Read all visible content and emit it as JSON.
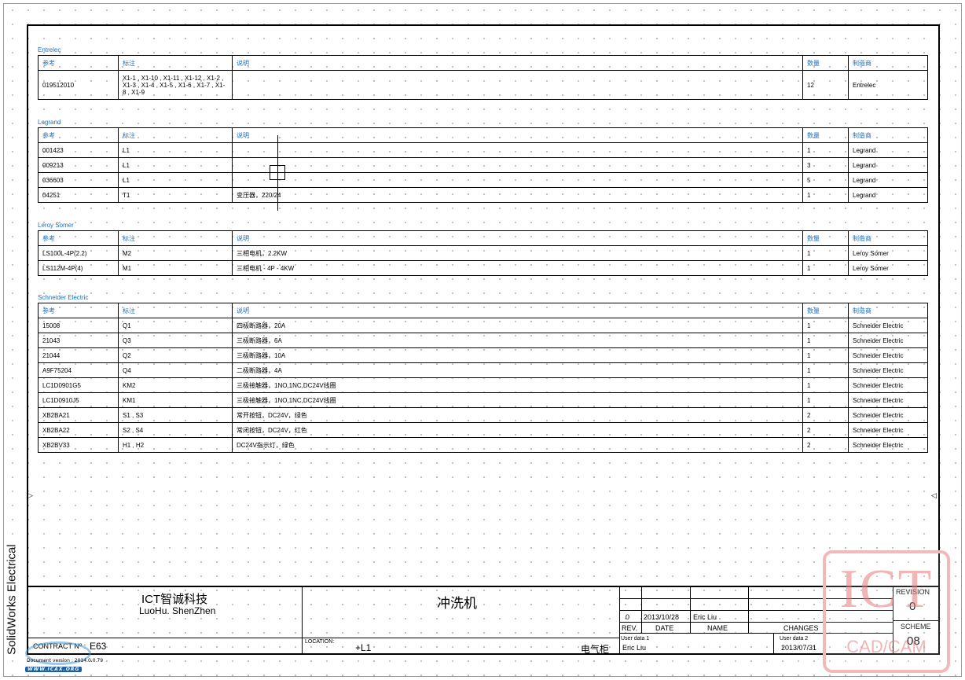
{
  "side_label": "SolidWorks Electrical",
  "headers": {
    "ref": "参考",
    "mark": "标注",
    "desc": "说明",
    "qty": "数量",
    "mfr": "制造商"
  },
  "groups": [
    {
      "title": "Entrelec",
      "rows": [
        {
          "ref": "019512010",
          "mark": "X1-1 , X1-10 , X1-11 , X1-12 , X1-2 , X1-3 , X1-4 , X1-5 , X1-6 , X1-7 , X1-8 , X1-9",
          "desc": "",
          "qty": "12",
          "mfr": "Entrelec"
        }
      ]
    },
    {
      "title": "Legrand",
      "rows": [
        {
          "ref": "001423",
          "mark": "L1",
          "desc": "",
          "qty": "1",
          "mfr": "Legrand"
        },
        {
          "ref": "009213",
          "mark": "L1",
          "desc": "",
          "qty": "3",
          "mfr": "Legrand"
        },
        {
          "ref": "036603",
          "mark": "L1",
          "desc": "",
          "qty": "5",
          "mfr": "Legrand"
        },
        {
          "ref": "04251",
          "mark": "T1",
          "desc": "变压器，220/24",
          "qty": "1",
          "mfr": "Legrand"
        }
      ]
    },
    {
      "title": "Leroy Somer",
      "rows": [
        {
          "ref": "LS100L-4P(2.2)",
          "mark": "M2",
          "desc": "三相电机，2.2KW",
          "qty": "1",
          "mfr": "Leroy Somer"
        },
        {
          "ref": "LS112M-4P(4)",
          "mark": "M1",
          "desc": "三相电机 - 4P - 4KW",
          "qty": "1",
          "mfr": "Leroy Somer"
        }
      ]
    },
    {
      "title": "Schneider Electric",
      "rows": [
        {
          "ref": "15008",
          "mark": "Q1",
          "desc": "四极断路器，20A",
          "qty": "1",
          "mfr": "Schneider Electric"
        },
        {
          "ref": "21043",
          "mark": "Q3",
          "desc": "三极断路器，6A",
          "qty": "1",
          "mfr": "Schneider Electric"
        },
        {
          "ref": "21044",
          "mark": "Q2",
          "desc": "三极断路器，10A",
          "qty": "1",
          "mfr": "Schneider Electric"
        },
        {
          "ref": "A9F75204",
          "mark": "Q4",
          "desc": "二极断路器，4A",
          "qty": "1",
          "mfr": "Schneider Electric"
        },
        {
          "ref": "LC1D0901G5",
          "mark": "KM2",
          "desc": "三极接触器，1NO,1NC,DC24V线圈",
          "qty": "1",
          "mfr": "Schneider Electric"
        },
        {
          "ref": "LC1D0910J5",
          "mark": "KM1",
          "desc": "三极接触器，1NO,1NC,DC24V线圈",
          "qty": "1",
          "mfr": "Schneider Electric"
        },
        {
          "ref": "XB2BA21",
          "mark": "S1 , S3",
          "desc": "常开按钮，DC24V，绿色",
          "qty": "2",
          "mfr": "Schneider Electric"
        },
        {
          "ref": "XB2BA22",
          "mark": "S2 , S4",
          "desc": "常闭按钮，DC24V，红色",
          "qty": "2",
          "mfr": "Schneider Electric"
        },
        {
          "ref": "XB2BV33",
          "mark": "H1 , H2",
          "desc": "DC24V指示灯，绿色",
          "qty": "2",
          "mfr": "Schneider Electric"
        }
      ]
    }
  ],
  "title_block": {
    "company": "ICT智诚科技",
    "location_city": "LuoHu. ShenZhen",
    "project": "冲洗机",
    "contract_label": "CONTRACT Nº :",
    "contract_no": "E63",
    "location_label": "LOCATION:",
    "location_value": "+L1",
    "cabinet": "电气柜",
    "rev_value": "0",
    "rev_date": "2013/10/28",
    "rev_name": "Eric Liu",
    "col_rev": "REV.",
    "col_date": "DATE",
    "col_name": "NAME",
    "col_changes": "CHANGES",
    "revision_label": "REVISION",
    "revision_value": "0",
    "scheme_label": "SCHEME",
    "scheme_value": "08",
    "user1_label": "User data 1",
    "user1_value": "Eric Liu",
    "user2_label": "User data 2",
    "user2_value": "2013/07/31"
  },
  "watermark": {
    "brand": "ICT",
    "subtitle": "CAD/CAM"
  },
  "logo": {
    "url_text": "WWW.ICAX.ORG",
    "doc_text": "Document version : 2014.0.0.79"
  },
  "colors": {
    "header_text": "#1f6fbf",
    "frame": "#000000",
    "watermark": "#e67878"
  }
}
